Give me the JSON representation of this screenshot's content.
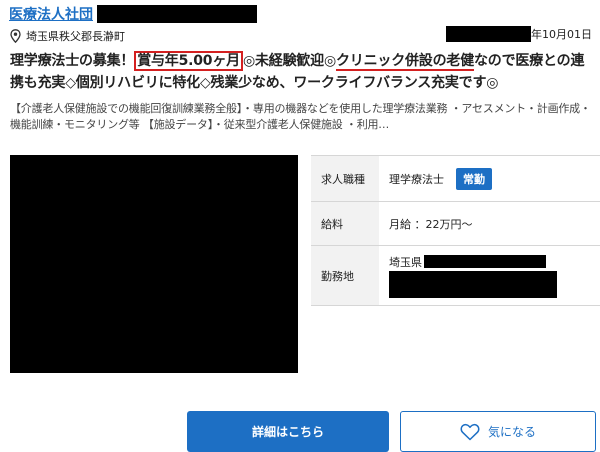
{
  "header": {
    "org_name": "医療法人社団",
    "location": "埼玉県秩父郡長瀞町",
    "date_suffix": "年10月01日"
  },
  "headline": {
    "part1": "理学療法士の募集！",
    "bonus": "賞与年5.00ヶ月",
    "part2": "◎未経験歓迎◎",
    "clinic": "クリニック併設の老健",
    "part3": "なので医療との連携も充実◇個別リハビリに特化◇残業少なめ、ワークライフバランス充実です◎"
  },
  "description": "【介護老人保健施設での機能回復訓練業務全般】・専用の機器などを使用した理学療法業務 ・アセスメント・計画作成・機能訓練・モニタリング等 【施設データ】・従来型介護老人保健施設 ・利用…",
  "info": {
    "job_type_label": "求人職種",
    "job_type_value": "理学療法士",
    "employment_badge": "常勤",
    "salary_label": "給料",
    "salary_value": "月給 ：22万円〜",
    "workplace_label": "勤務地",
    "workplace_prefix": "埼玉県"
  },
  "buttons": {
    "detail_label": "詳細はこちら",
    "favorite_label": "気になる"
  },
  "colors": {
    "accent": "#1d6fc4",
    "highlight": "#d42020"
  }
}
